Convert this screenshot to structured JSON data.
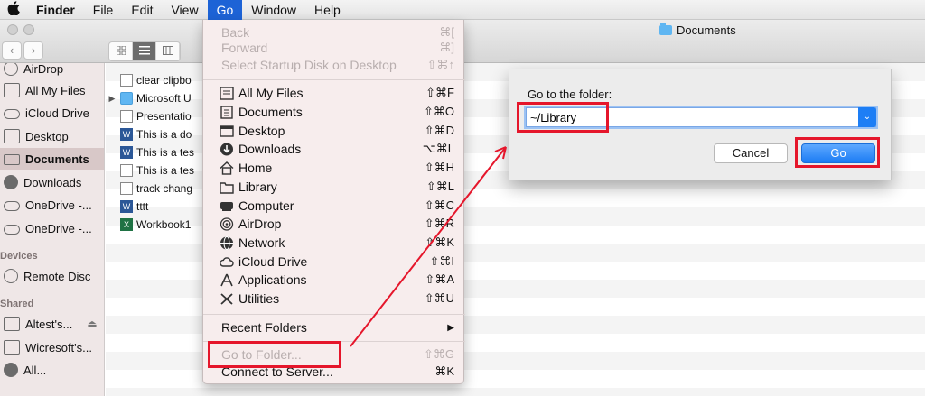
{
  "menubar": {
    "app": "Finder",
    "items": [
      "File",
      "Edit",
      "View",
      "Go",
      "Window",
      "Help"
    ],
    "active": "Go"
  },
  "window": {
    "title": "Documents",
    "back_glyph": "‹",
    "forward_glyph": "›"
  },
  "sidebar": {
    "items": [
      {
        "label": "AirDrop",
        "icon": "airdrop-icon"
      },
      {
        "label": "All My Files",
        "icon": "all-files-icon"
      },
      {
        "label": "iCloud Drive",
        "icon": "cloud-icon"
      },
      {
        "label": "Desktop",
        "icon": "desktop-icon"
      },
      {
        "label": "Documents",
        "icon": "documents-icon",
        "selected": true
      },
      {
        "label": "Downloads",
        "icon": "downloads-icon"
      },
      {
        "label": "OneDrive -...",
        "icon": "cloud-icon"
      },
      {
        "label": "OneDrive -...",
        "icon": "cloud-icon"
      }
    ],
    "devices_header": "Devices",
    "devices": [
      {
        "label": "Remote Disc",
        "icon": "disc-icon"
      }
    ],
    "shared_header": "Shared",
    "shared": [
      {
        "label": "Altest's...",
        "icon": "computer-icon",
        "eject": "⏏"
      },
      {
        "label": "Wicresoft's...",
        "icon": "computer-icon"
      },
      {
        "label": "All...",
        "icon": "network-icon"
      }
    ]
  },
  "files": [
    {
      "name": "clear clipbo",
      "type": "doc"
    },
    {
      "name": "Microsoft U",
      "type": "folder",
      "disclosure": "▶"
    },
    {
      "name": "Presentatio",
      "type": "doc"
    },
    {
      "name": "This is a do",
      "type": "word"
    },
    {
      "name": "This is a tes",
      "type": "word"
    },
    {
      "name": "This is a tes",
      "type": "doc"
    },
    {
      "name": "track chang",
      "type": "doc"
    },
    {
      "name": "tttt",
      "type": "word"
    },
    {
      "name": "Workbook1",
      "type": "excel"
    }
  ],
  "go_menu": {
    "disabled_top": [
      {
        "label": "Back",
        "shortcut": "⌘["
      },
      {
        "label": "Forward",
        "shortcut": "⌘]"
      },
      {
        "label": "Select Startup Disk on Desktop",
        "shortcut": "⇧⌘↑"
      }
    ],
    "places": [
      {
        "label": "All My Files",
        "shortcut": "⇧⌘F",
        "icon": "all-files-icon"
      },
      {
        "label": "Documents",
        "shortcut": "⇧⌘O",
        "icon": "documents-icon"
      },
      {
        "label": "Desktop",
        "shortcut": "⇧⌘D",
        "icon": "desktop-icon"
      },
      {
        "label": "Downloads",
        "shortcut": "⌥⌘L",
        "icon": "downloads-icon"
      },
      {
        "label": "Home",
        "shortcut": "⇧⌘H",
        "icon": "home-icon"
      },
      {
        "label": "Library",
        "shortcut": "⇧⌘L",
        "icon": "library-icon"
      },
      {
        "label": "Computer",
        "shortcut": "⇧⌘C",
        "icon": "computer-icon"
      },
      {
        "label": "AirDrop",
        "shortcut": "⇧⌘R",
        "icon": "airdrop-icon"
      },
      {
        "label": "Network",
        "shortcut": "⇧⌘K",
        "icon": "network-icon"
      },
      {
        "label": "iCloud Drive",
        "shortcut": "⇧⌘I",
        "icon": "cloud-icon"
      },
      {
        "label": "Applications",
        "shortcut": "⇧⌘A",
        "icon": "applications-icon"
      },
      {
        "label": "Utilities",
        "shortcut": "⇧⌘U",
        "icon": "utilities-icon"
      }
    ],
    "recent_folders": {
      "label": "Recent Folders",
      "submenu": "▶"
    },
    "go_to_folder": {
      "label": "Go to Folder...",
      "shortcut": "⇧⌘G"
    },
    "connect_to_server": {
      "label": "Connect to Server...",
      "shortcut": "⌘K"
    }
  },
  "dialog": {
    "label": "Go to the folder:",
    "value": "~/Library",
    "combo_glyph": "⌄",
    "cancel": "Cancel",
    "go": "Go"
  },
  "colors": {
    "accent": "#1d63d6",
    "highlight": "#e5162b"
  }
}
